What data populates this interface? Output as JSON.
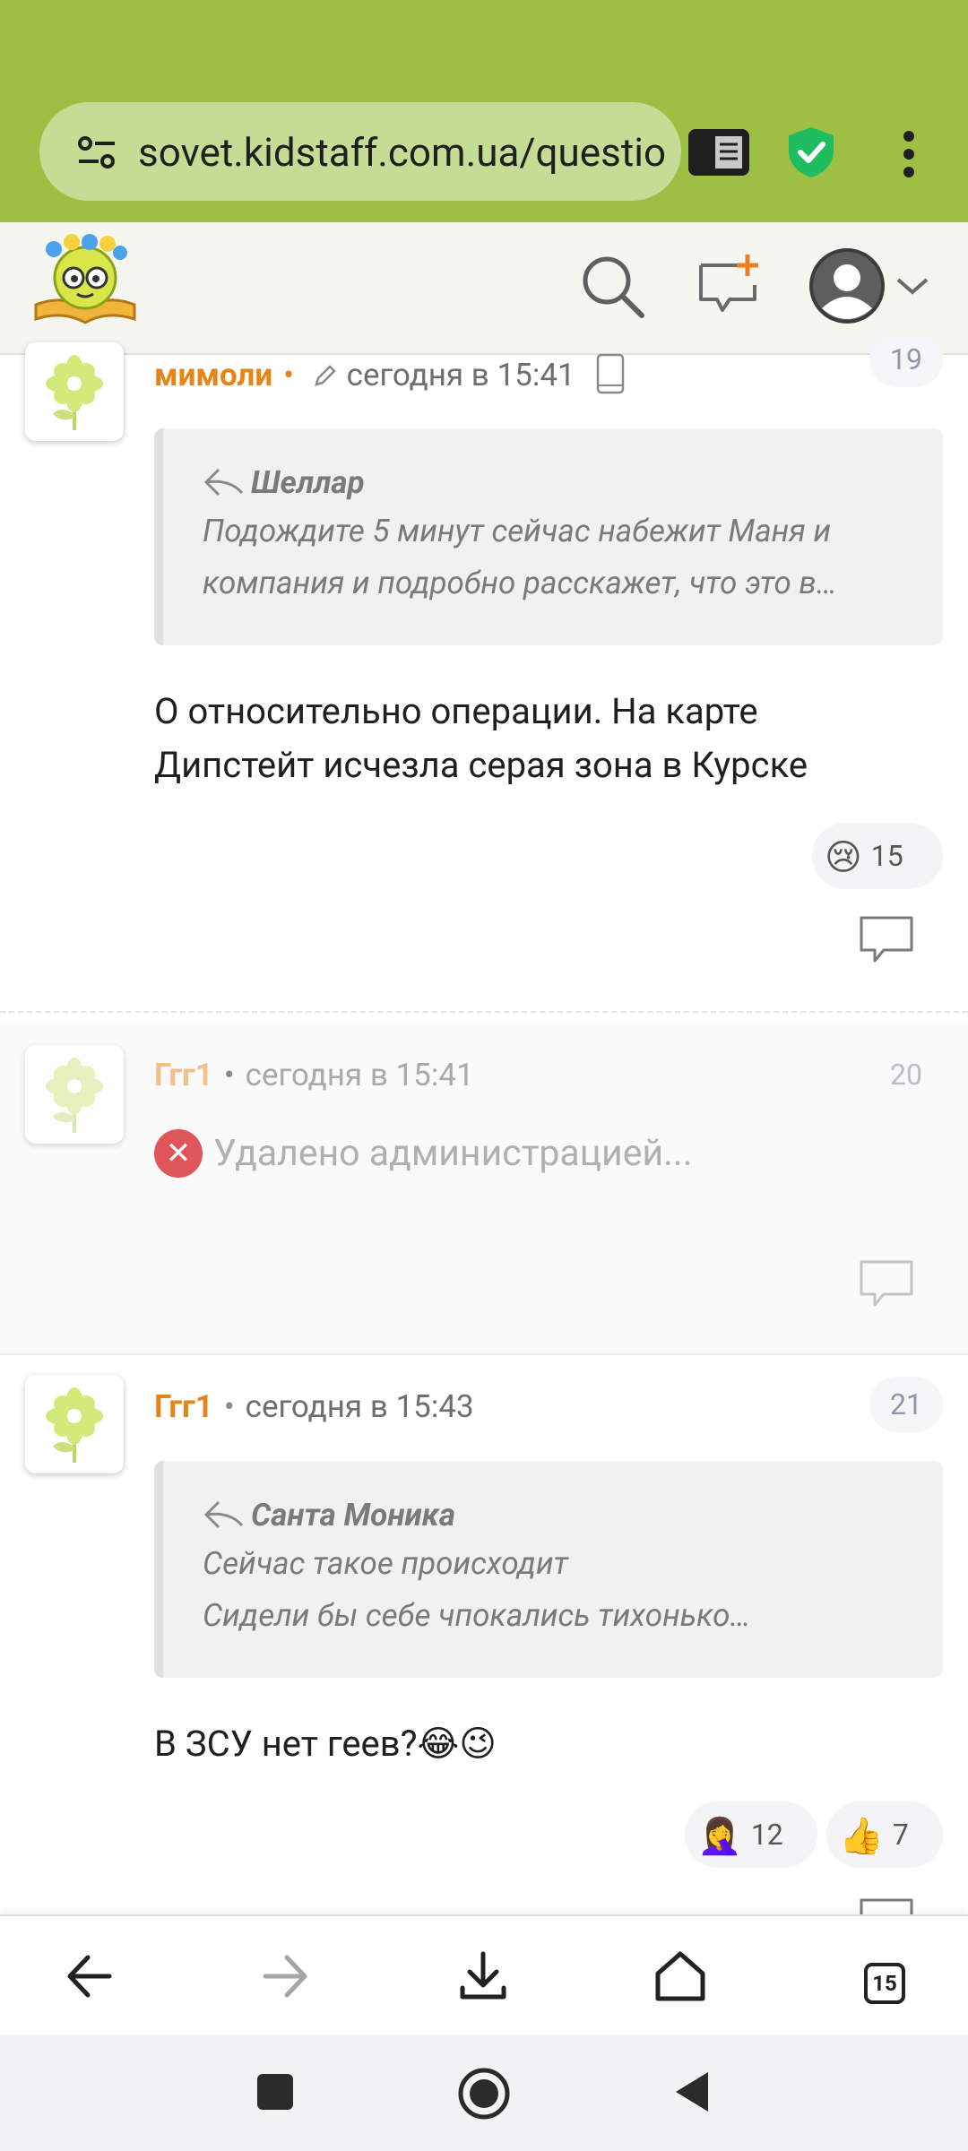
{
  "browser": {
    "url": "sovet.kidstaff.com.ua/questio",
    "tabs_count": "15"
  },
  "comments": [
    {
      "author": "мимоли",
      "time": "сегодня в 15:41",
      "number": "19",
      "quote_author": "Шеллар",
      "quote_lines": [
        "Подождите 5 минут сейчас набежит Маня и",
        "компания и подробно расскажет, что это в…"
      ],
      "body_lines": [
        "О относительно операции. На карте",
        "Дипстейт исчезла серая зона в Курске"
      ],
      "reactions": [
        {
          "emoji": "😢",
          "count": "15"
        }
      ]
    },
    {
      "author": "Ггг1",
      "time": "сегодня в 15:41",
      "number": "20",
      "deleted_text": "Удалено администрацией..."
    },
    {
      "author": "Ггг1",
      "time": "сегодня в 15:43",
      "number": "21",
      "quote_author": "Санта Моника",
      "quote_lines": [
        "Сейчас такое происходит",
        "Сидели бы себе чпокались тихонько…"
      ],
      "body_lines": [
        "В ЗСУ нет геев?😂😉"
      ],
      "reactions": [
        {
          "emoji": "🤦‍♀️",
          "count": "12"
        },
        {
          "emoji": "👍",
          "count": "7"
        }
      ]
    }
  ],
  "icons": {
    "site_settings": "tune-icon",
    "reader_mode": "reader-mode-icon",
    "security": "shield-check-icon",
    "menu": "more-vert-icon",
    "search": "search-icon",
    "new_message": "chat-plus-icon",
    "profile": "account-circle-icon",
    "reply": "reply-bubble-icon"
  },
  "colors": {
    "browser_bar": "#9dc044",
    "author": "#e58417",
    "accent_orange": "#f07c1b"
  }
}
